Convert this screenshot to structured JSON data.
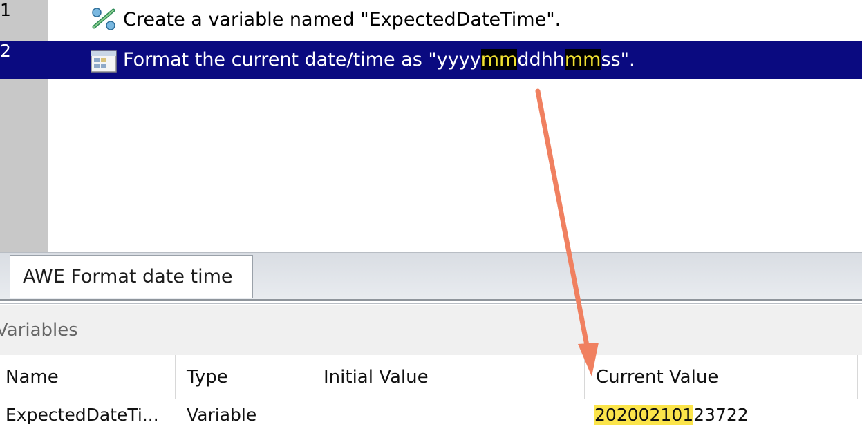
{
  "script_lines": [
    {
      "number": "1",
      "icon": "variable-icon",
      "text": "Create a variable named \"ExpectedDateTime\"."
    },
    {
      "number": "2",
      "icon": "format-date-icon",
      "text_before": "Format the current date/time as \"yyyy",
      "highlight_1": "mm",
      "text_mid": "ddhh",
      "highlight_2": "mm",
      "text_after": "ss\"."
    }
  ],
  "tab": {
    "label": "AWE Format date time"
  },
  "variables_panel": {
    "title": "Variables",
    "columns": [
      "Name",
      "Type",
      "Initial Value",
      "Current Value"
    ],
    "rows": [
      {
        "name": "ExpectedDateTi...",
        "type": "Variable",
        "initial_value": "",
        "current_value_highlight": "202002101",
        "current_value_rest": "23722"
      }
    ]
  },
  "colors": {
    "selection": "#0a0a80",
    "highlight_yellow": "#fbe44a",
    "arrow": "#f08060"
  }
}
